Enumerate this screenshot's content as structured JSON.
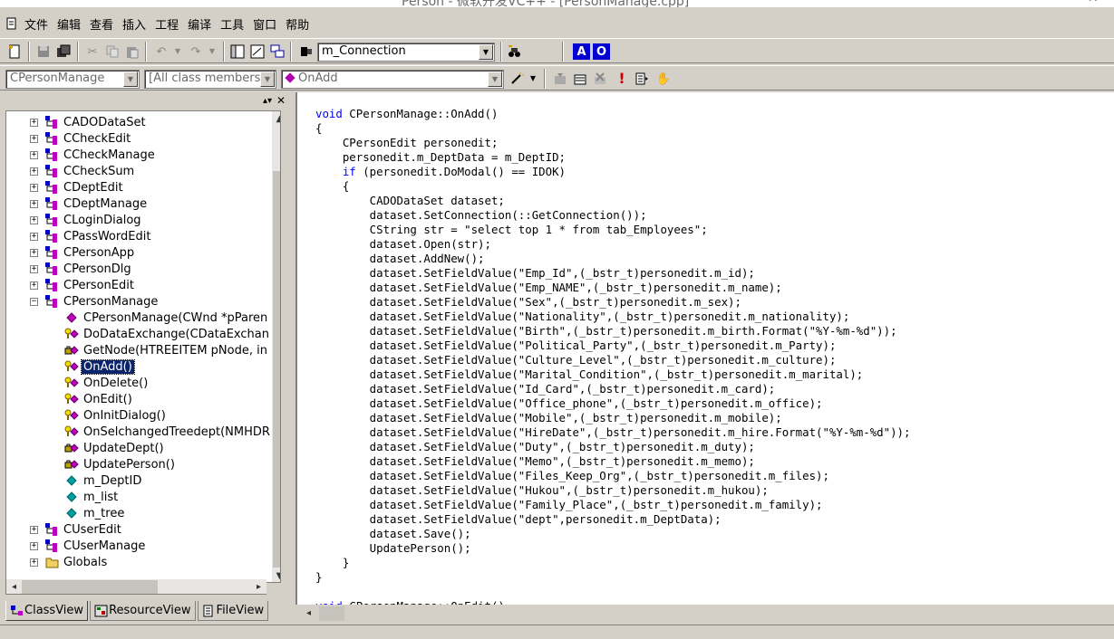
{
  "window": {
    "title": "Person - 微软开发VC++ - [PersonManage.cpp]"
  },
  "menu": {
    "items": [
      "文件",
      "编辑",
      "查看",
      "插入",
      "工程",
      "编译",
      "工具",
      "窗口",
      "帮助"
    ]
  },
  "toolbar": {
    "find_combo_value": "m_Connection",
    "blue_btn_a": "A",
    "blue_btn_o": "O"
  },
  "wizardbar": {
    "class_combo": "CPersonManage",
    "filter_combo": "[All class members]",
    "member_combo": "OnAdd"
  },
  "classview": {
    "classes": [
      "CADODataSet",
      "CCheckEdit",
      "CCheckManage",
      "CCheckSum",
      "CDeptEdit",
      "CDeptManage",
      "CLoginDialog",
      "CPassWordEdit",
      "CPersonApp",
      "CPersonDlg",
      "CPersonEdit",
      "CPersonManage"
    ],
    "members": [
      "CPersonManage(CWnd *pParen",
      "DoDataExchange(CDataExchan",
      "GetNode(HTREEITEM pNode, in",
      "OnAdd()",
      "OnDelete()",
      "OnEdit()",
      "OnInitDialog()",
      "OnSelchangedTreedept(NMHDR",
      "UpdateDept()",
      "UpdatePerson()",
      "m_DeptID",
      "m_list",
      "m_tree"
    ],
    "after": [
      "CUserEdit",
      "CUserManage",
      "Globals"
    ],
    "selected_member": "OnAdd()"
  },
  "tabs": [
    "ClassView",
    "ResourceView",
    "FileView"
  ],
  "code": {
    "lines": [
      [
        "void",
        " CPersonManage::OnAdd()"
      ],
      [
        "",
        "{"
      ],
      [
        "",
        "    CPersonEdit personedit;"
      ],
      [
        "",
        "    personedit.m_DeptData = m_DeptID;"
      ],
      [
        "    if",
        " (personedit.DoModal() == IDOK)"
      ],
      [
        "",
        "    {"
      ],
      [
        "",
        "        CADODataSet dataset;"
      ],
      [
        "",
        "        dataset.SetConnection(::GetConnection());"
      ],
      [
        "",
        "        CString str = \"select top 1 * from tab_Employees\";"
      ],
      [
        "",
        "        dataset.Open(str);"
      ],
      [
        "",
        "        dataset.AddNew();"
      ],
      [
        "",
        "        dataset.SetFieldValue(\"Emp_Id\",(_bstr_t)personedit.m_id);"
      ],
      [
        "",
        "        dataset.SetFieldValue(\"Emp_NAME\",(_bstr_t)personedit.m_name);"
      ],
      [
        "",
        "        dataset.SetFieldValue(\"Sex\",(_bstr_t)personedit.m_sex);"
      ],
      [
        "",
        "        dataset.SetFieldValue(\"Nationality\",(_bstr_t)personedit.m_nationality);"
      ],
      [
        "",
        "        dataset.SetFieldValue(\"Birth\",(_bstr_t)personedit.m_birth.Format(\"%Y-%m-%d\"));"
      ],
      [
        "",
        "        dataset.SetFieldValue(\"Political_Party\",(_bstr_t)personedit.m_Party);"
      ],
      [
        "",
        "        dataset.SetFieldValue(\"Culture_Level\",(_bstr_t)personedit.m_culture);"
      ],
      [
        "",
        "        dataset.SetFieldValue(\"Marital_Condition\",(_bstr_t)personedit.m_marital);"
      ],
      [
        "",
        "        dataset.SetFieldValue(\"Id_Card\",(_bstr_t)personedit.m_card);"
      ],
      [
        "",
        "        dataset.SetFieldValue(\"Office_phone\",(_bstr_t)personedit.m_office);"
      ],
      [
        "",
        "        dataset.SetFieldValue(\"Mobile\",(_bstr_t)personedit.m_mobile);"
      ],
      [
        "",
        "        dataset.SetFieldValue(\"HireDate\",(_bstr_t)personedit.m_hire.Format(\"%Y-%m-%d\"));"
      ],
      [
        "",
        "        dataset.SetFieldValue(\"Duty\",(_bstr_t)personedit.m_duty);"
      ],
      [
        "",
        "        dataset.SetFieldValue(\"Memo\",(_bstr_t)personedit.m_memo);"
      ],
      [
        "",
        "        dataset.SetFieldValue(\"Files_Keep_Org\",(_bstr_t)personedit.m_files);"
      ],
      [
        "",
        "        dataset.SetFieldValue(\"Hukou\",(_bstr_t)personedit.m_hukou);"
      ],
      [
        "",
        "        dataset.SetFieldValue(\"Family_Place\",(_bstr_t)personedit.m_family);"
      ],
      [
        "",
        "        dataset.SetFieldValue(\"dept\",personedit.m_DeptData);"
      ],
      [
        "",
        "        dataset.Save();"
      ],
      [
        "",
        "        UpdatePerson();"
      ],
      [
        "",
        "    }"
      ],
      [
        "",
        "}"
      ],
      [
        "",
        ""
      ],
      [
        "void",
        " CPersonManage::OnEdit()"
      ]
    ]
  },
  "colors": {
    "keyword": "#0000ff",
    "selection": "#0a246a",
    "chrome": "#d4d0c8"
  }
}
